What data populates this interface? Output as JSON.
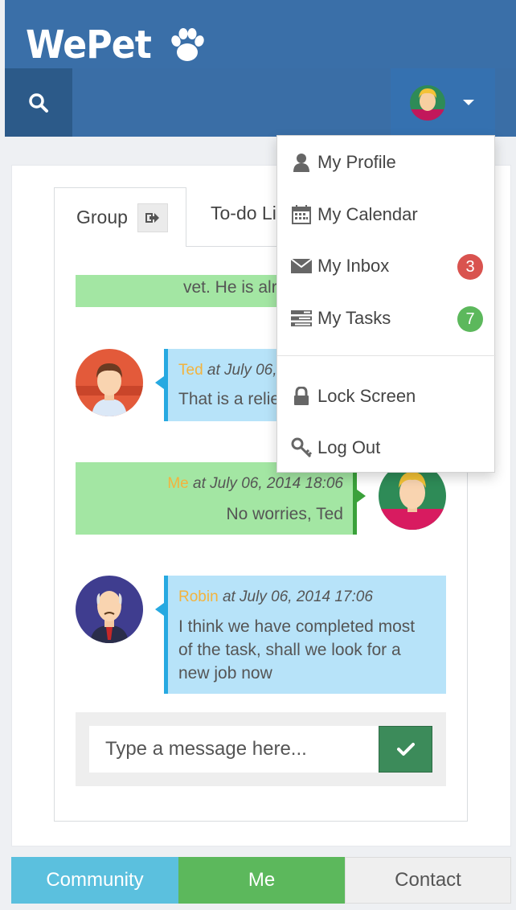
{
  "app": {
    "brand": "WePet"
  },
  "tabs": {
    "group": "Group",
    "todo": "To-do Li"
  },
  "messages": {
    "partial": "vet. He is alr",
    "ted": {
      "sender": "Ted",
      "time": "at July 06,",
      "text": "That is a relie"
    },
    "me": {
      "sender": "Me",
      "time": "at July 06, 2014 18:06",
      "text": "No worries, Ted"
    },
    "robin": {
      "sender": "Robin",
      "time": "at July 06, 2014 17:06",
      "line1": "I think we have completed most",
      "line2": "of the task, shall we look for a",
      "line3": "new job now"
    }
  },
  "composer": {
    "placeholder": "Type a message here..."
  },
  "bottom_tabs": {
    "community": "Community",
    "me": "Me",
    "contact": "Contact"
  },
  "dropdown": {
    "profile": "My Profile",
    "calendar": "My Calendar",
    "inbox": "My Inbox",
    "inbox_count": "3",
    "tasks": "My Tasks",
    "tasks_count": "7",
    "lock": "Lock Screen",
    "logout": "Log Out"
  },
  "colors": {
    "header": "#3a6fa8",
    "search_bg": "#2c5a89",
    "bubble_blue": "#b7e3f9",
    "bubble_green": "#a3e6a3",
    "accent_name": "#f3b33d",
    "send_button": "#3c8b5a",
    "tab_community": "#5bc0de",
    "tab_me": "#5cb85c"
  }
}
